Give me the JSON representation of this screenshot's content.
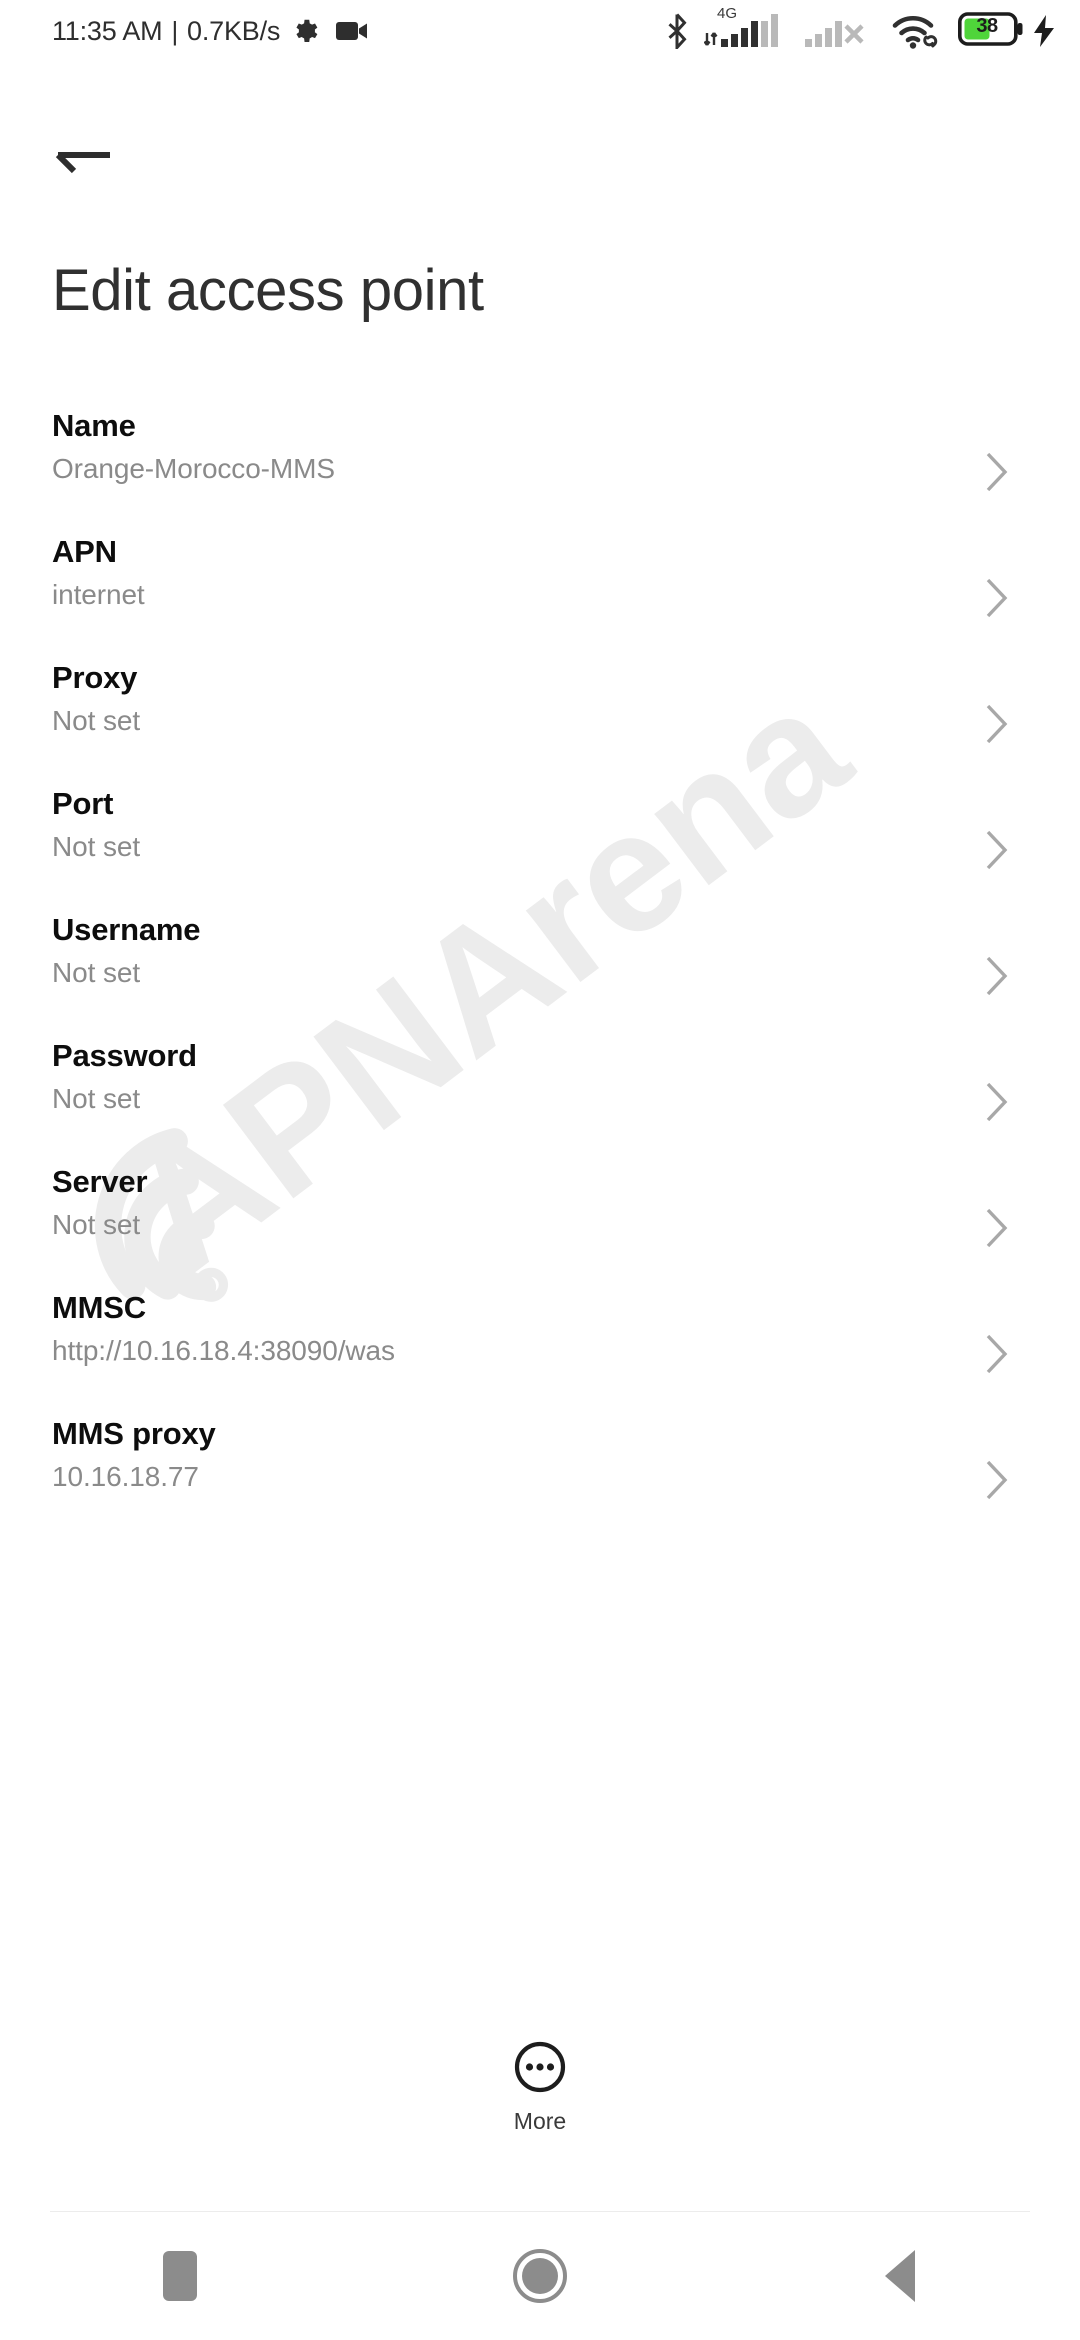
{
  "status_bar": {
    "clock": "11:35 AM",
    "separator": "|",
    "network_speed": "0.7KB/s",
    "network_type": "4G",
    "battery_level": "38",
    "icons": {
      "gear": "gear-icon",
      "camera": "video-camera-icon",
      "bluetooth": "bluetooth-icon",
      "signal_sim1": "signal-bars-sim1-icon",
      "signal_sim2": "signal-bars-sim2-no-service-icon",
      "wifi": "wifi-link-icon",
      "battery": "battery-icon",
      "charging": "charging-bolt-icon"
    },
    "colors": {
      "battery_fill": "#4FD53A",
      "icon_dark": "#303030",
      "icon_light": "#b9b9b9"
    }
  },
  "header": {
    "back_icon": "arrow-left-icon",
    "title": "Edit access point"
  },
  "watermark": {
    "text": "APNArena",
    "color": "#ececec"
  },
  "list": {
    "chevron_icon": "chevron-right-icon",
    "items": [
      {
        "label": "Name",
        "value": "Orange-Morocco-MMS"
      },
      {
        "label": "APN",
        "value": "internet"
      },
      {
        "label": "Proxy",
        "value": "Not set"
      },
      {
        "label": "Port",
        "value": "Not set"
      },
      {
        "label": "Username",
        "value": "Not set"
      },
      {
        "label": "Password",
        "value": "Not set"
      },
      {
        "label": "Server",
        "value": "Not set"
      },
      {
        "label": "MMSC",
        "value": "http://10.16.18.4:38090/was"
      },
      {
        "label": "MMS proxy",
        "value": "10.16.18.77"
      }
    ]
  },
  "more_button": {
    "label": "More",
    "icon": "more-dots-circle-icon"
  },
  "nav_bar": {
    "recent_label": "recent-apps",
    "home_label": "home",
    "back_label": "back",
    "color": "#8c8c8c"
  }
}
